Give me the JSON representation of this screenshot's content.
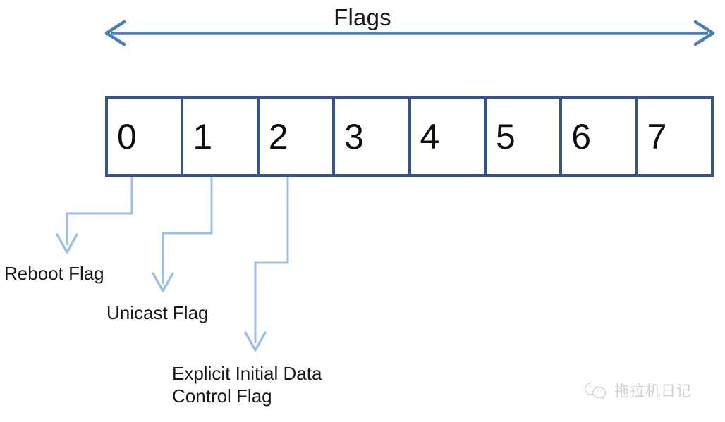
{
  "diagram": {
    "span": {
      "title": "Flags",
      "arrow_color": "#4a7ebb",
      "left_arrow_icon": "arrow-left-icon",
      "right_arrow_icon": "arrow-right-icon"
    },
    "bitfield": {
      "border_color": "#34558b",
      "fill_color": "#ffffff",
      "text_color": "#0d0d0d",
      "cells": [
        {
          "label": "0"
        },
        {
          "label": "1"
        },
        {
          "label": "2"
        },
        {
          "label": "3"
        },
        {
          "label": "4"
        },
        {
          "label": "5"
        },
        {
          "label": "6"
        },
        {
          "label": "7"
        }
      ]
    },
    "callouts": {
      "connector_color": "#9cc0e4",
      "items": [
        {
          "bit": "0",
          "label": "Reboot Flag"
        },
        {
          "bit": "1",
          "label": "Unicast Flag"
        },
        {
          "bit": "2",
          "label": "Explicit Initial Data\nControl Flag"
        }
      ]
    },
    "watermark": {
      "icon": "wechat-logo-icon",
      "text": "拖拉机日记",
      "color": "#b4b4b4"
    }
  }
}
